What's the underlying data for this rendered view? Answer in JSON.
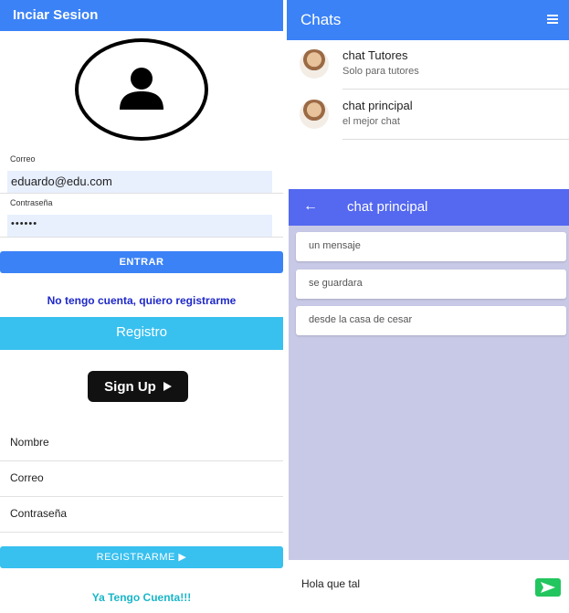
{
  "login": {
    "header_title": "Inciar Sesion",
    "email_label": "Correo",
    "email_value": "eduardo@edu.com",
    "password_label": "Contraseña",
    "password_value": "••••••",
    "enter_button": "ENTRAR",
    "no_account_link": "No tengo cuenta, quiero registrarme"
  },
  "register": {
    "header_title": "Registro",
    "signup_label": "Sign Up",
    "fields": [
      "Nombre",
      "Correo",
      "Contraseña"
    ],
    "register_button": "REGISTRARME ▶",
    "have_account_link": "Ya Tengo Cuenta!!!"
  },
  "chats": {
    "title": "Chats",
    "items": [
      {
        "name": "chat Tutores",
        "subtitle": "Solo para tutores"
      },
      {
        "name": "chat principal",
        "subtitle": "el mejor chat"
      }
    ]
  },
  "chat_window": {
    "title": "chat principal",
    "messages": [
      "un mensaje",
      "se guardara",
      "desde la casa de cesar"
    ],
    "compose_value": "Hola que tal"
  },
  "colors": {
    "primary_blue": "#3b82f6",
    "cyan": "#38c0ef",
    "chat_header": "#5468f0",
    "chat_bg": "#c8c9e6",
    "send_green": "#22c55e"
  }
}
